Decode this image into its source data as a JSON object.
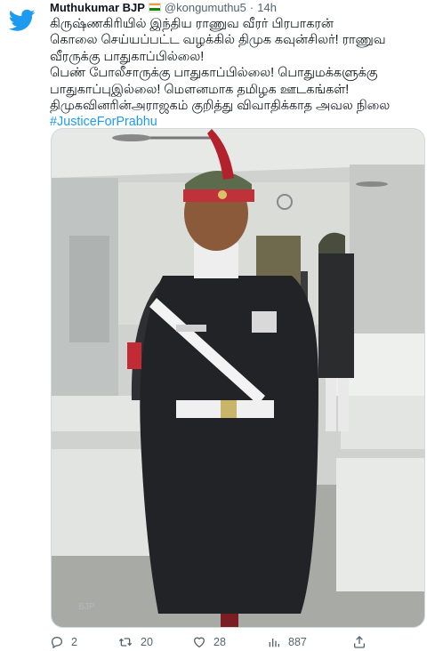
{
  "tweet": {
    "author_name": "Muthukumar BJP",
    "handle": "@kongumuthu5",
    "separator": "·",
    "time": "14h",
    "lines": [
      "கிருஷ்ணகிரியில் இந்திய ராணுவ வீரர் பிரபாகரன்",
      "கொலை செய்யப்பட்ட வழக்கில் திமுக கவுன்சிலர்! ராணுவ",
      "வீரருக்கு பாதுகாப்பில்லை!",
      "பெண் போலீசாருக்கு பாதுகாப்பில்லை! பொதுமக்களுக்கு",
      "பாதுகாப்புஇல்லை! மௌனமாக தமிழக ஊடகங்கள்!",
      "திமுகவினரின்அராஜகம் குறித்து விவாதிக்காத அவல நிலை"
    ],
    "hashtag": "#JusticeForPrabhu",
    "media_caption_text": "BJP",
    "stats": {
      "replies": "2",
      "retweets": "20",
      "likes": "28",
      "views": "887"
    }
  },
  "icons": {
    "logo": "twitter-bird-icon",
    "flag": "india-flag-icon",
    "reply": "reply-icon",
    "retweet": "retweet-icon",
    "like": "heart-icon",
    "views": "views-icon",
    "share": "share-icon"
  },
  "colors": {
    "brand": "#1d9bf0",
    "text": "#0f1419",
    "muted": "#536471"
  }
}
